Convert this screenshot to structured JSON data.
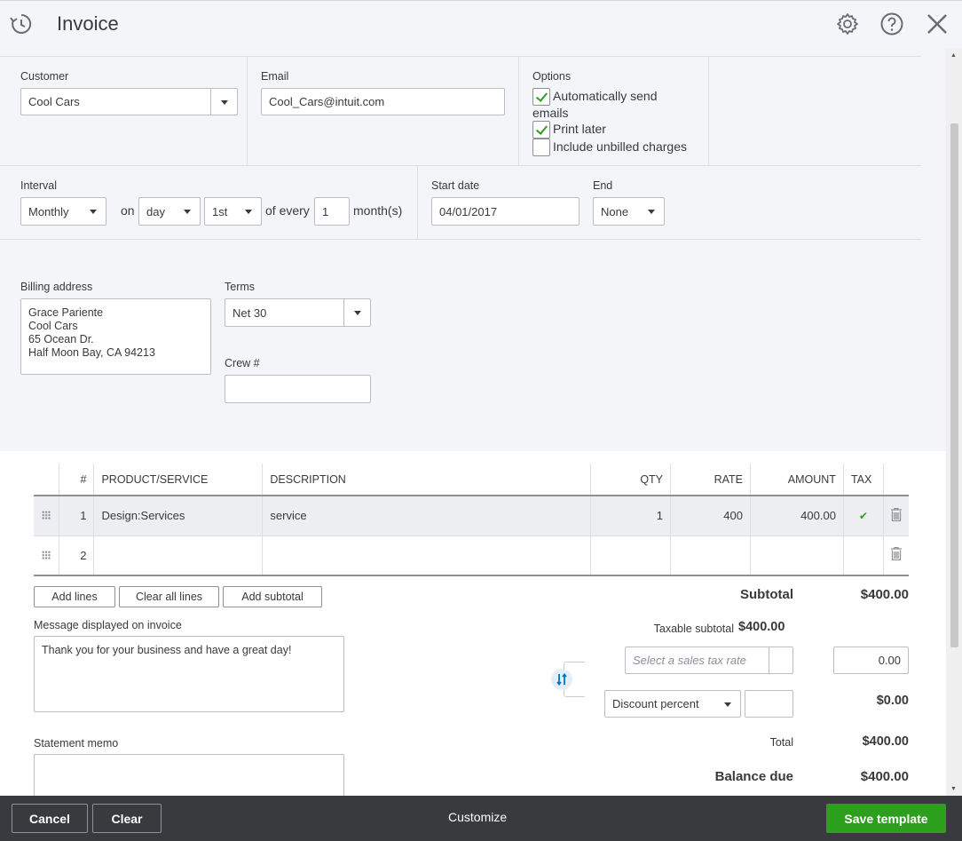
{
  "header": {
    "title": "Invoice",
    "settings_icon": "gear-icon",
    "help_icon": "help-icon",
    "close_icon": "close-icon",
    "history_icon": "history-icon"
  },
  "customer": {
    "label": "Customer",
    "value": "Cool Cars"
  },
  "email": {
    "label": "Email",
    "value": "Cool_Cars@intuit.com"
  },
  "options": {
    "label": "Options",
    "auto_send_1": "Automatically send",
    "auto_send_2": "emails",
    "auto_send_checked": true,
    "print_later": "Print later",
    "print_later_checked": true,
    "unbilled": "Include unbilled charges",
    "unbilled_checked": false
  },
  "interval": {
    "label": "Interval",
    "value": "Monthly",
    "on": "on",
    "day_value": "day",
    "nth_value": "1st",
    "of_every": "of every",
    "every_value": "1",
    "months": "month(s)"
  },
  "start_date": {
    "label": "Start date",
    "value": "04/01/2017"
  },
  "end": {
    "label": "End",
    "value": "None"
  },
  "billing": {
    "label": "Billing address",
    "lines": [
      "Grace Pariente",
      "Cool Cars",
      "65 Ocean Dr.",
      "Half Moon Bay, CA  94213"
    ]
  },
  "terms": {
    "label": "Terms",
    "value": "Net 30"
  },
  "crew": {
    "label": "Crew #",
    "value": ""
  },
  "table": {
    "headers": {
      "num": "#",
      "product": "PRODUCT/SERVICE",
      "description": "DESCRIPTION",
      "qty": "QTY",
      "rate": "RATE",
      "amount": "AMOUNT",
      "tax": "TAX"
    },
    "rows": [
      {
        "num": "1",
        "product": "Design:Services",
        "description": "service",
        "qty": "1",
        "rate": "400",
        "amount": "400.00",
        "tax": "✔"
      },
      {
        "num": "2",
        "product": "",
        "description": "",
        "qty": "",
        "rate": "",
        "amount": "",
        "tax": ""
      }
    ]
  },
  "buttons": {
    "add_lines": "Add lines",
    "clear_all": "Clear all lines",
    "add_subtotal": "Add subtotal"
  },
  "message": {
    "label": "Message displayed on invoice",
    "value": "Thank you for your business and have a great day!"
  },
  "memo": {
    "label": "Statement memo",
    "value": ""
  },
  "totals": {
    "subtotal_label": "Subtotal",
    "subtotal_value": "$400.00",
    "taxable_label": "Taxable subtotal",
    "taxable_value": "$400.00",
    "tax_rate_placeholder": "Select a sales tax rate",
    "tax_amount": "0.00",
    "discount_type": "Discount percent",
    "discount_input": "",
    "discount_value": "$0.00",
    "total_label": "Total",
    "total_value": "$400.00",
    "balance_label": "Balance due",
    "balance_value": "$400.00"
  },
  "footer": {
    "cancel": "Cancel",
    "clear": "Clear",
    "customize": "Customize",
    "save": "Save template"
  },
  "colors": {
    "green": "#2ca01c",
    "footer_bg": "#393a3d",
    "panel_bg": "#f4f5f8"
  }
}
